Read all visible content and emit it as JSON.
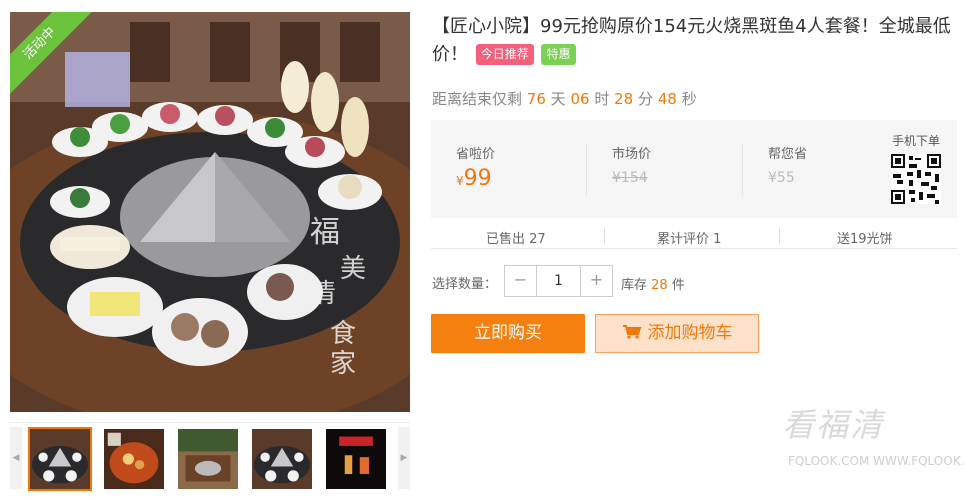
{
  "product": {
    "badge": "活动中",
    "title": "【匠心小院】99元抢购原价154元火烧黑斑鱼4人套餐！全城最低价！",
    "tags": [
      "今日推荐",
      "特惠"
    ]
  },
  "countdown": {
    "prefix": "距离结束仅剩",
    "days": "76",
    "days_unit": "天",
    "hours": "06",
    "hours_unit": "时",
    "minutes": "28",
    "minutes_unit": "分",
    "seconds": "48",
    "seconds_unit": "秒"
  },
  "prices": {
    "saved_label": "省啦价",
    "saved_currency": "¥",
    "saved_value": "99",
    "market_label": "市场价",
    "market_value": "¥154",
    "you_save_label": "帮您省",
    "you_save_value": "¥55",
    "qr_label": "手机下单"
  },
  "stats": {
    "sold": "已售出 27",
    "reviews": "累计评价 1",
    "gift": "送19光饼"
  },
  "quantity": {
    "label": "选择数量：",
    "minus": "−",
    "plus": "+",
    "value": "1",
    "stock_prefix": "库存",
    "stock_count": "28",
    "stock_unit": "件"
  },
  "actions": {
    "buy": "立即购买",
    "add_cart": "添加购物车"
  },
  "watermark": {
    "big": "看福清",
    "small": "FQLOOK.COM  WWW.FQLOOK.COM"
  },
  "colors": {
    "accent": "#f0780a",
    "badge_green": "#6cc23a",
    "tag_pink": "#f2607c",
    "tag_green": "#7cd055"
  },
  "icons": [
    "left-arrow-icon",
    "right-arrow-icon",
    "cart-icon",
    "qr-code-icon"
  ]
}
